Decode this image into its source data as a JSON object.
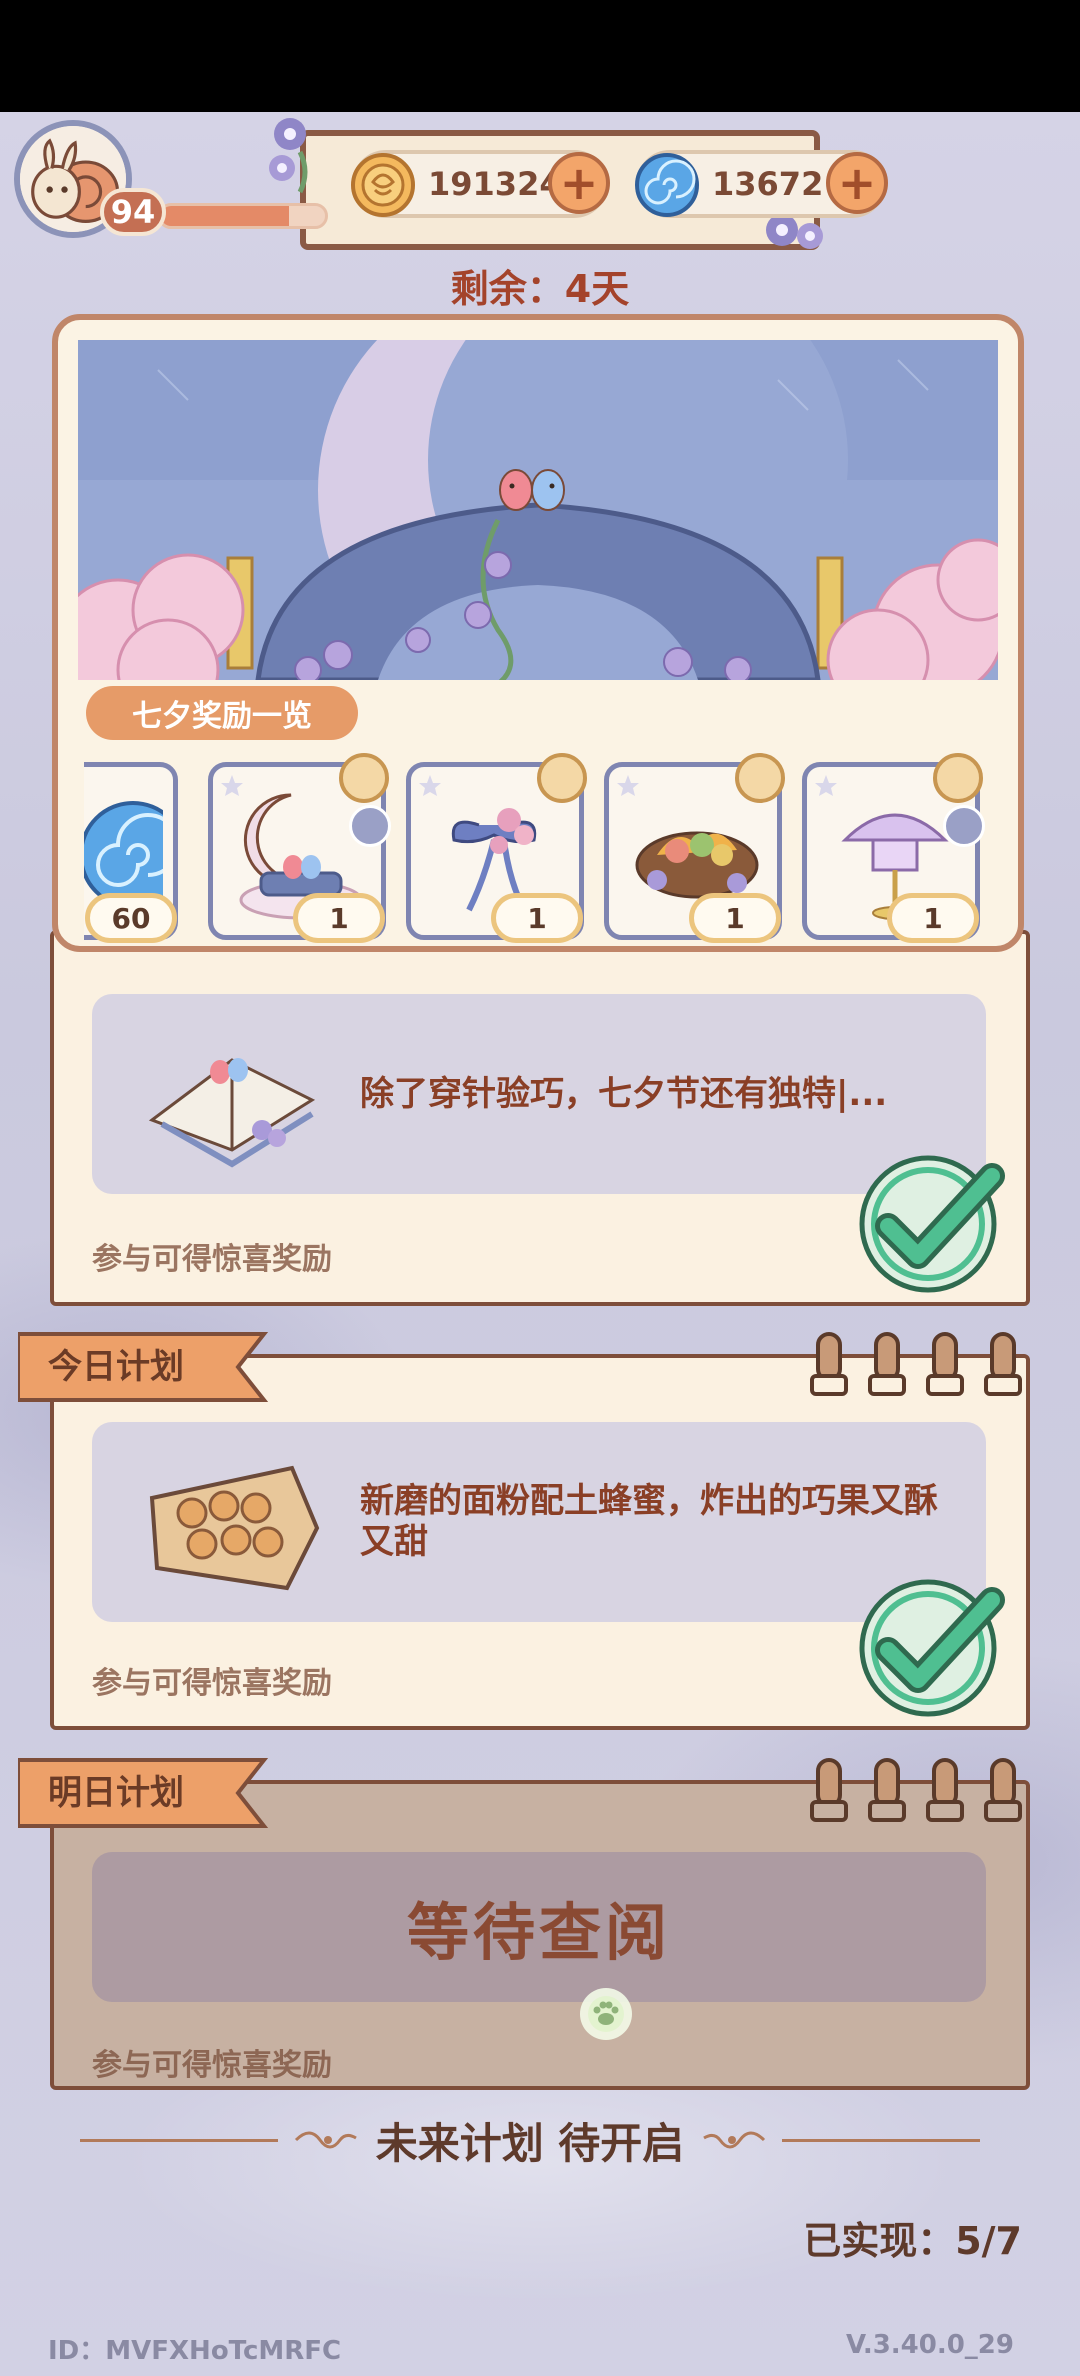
{
  "hud": {
    "level": "94",
    "exp_fraction": 0.78,
    "coins": "191324",
    "gems": "13672",
    "plus_symbol": "+"
  },
  "event": {
    "remaining": "剩余：4天",
    "reward_list_label": "七夕奖励一览",
    "rewards": [
      {
        "name": "blue-swirl-gem",
        "count": "60"
      },
      {
        "name": "moon-bird-bed",
        "count": "1"
      },
      {
        "name": "flower-ribbon",
        "count": "1"
      },
      {
        "name": "fruit-basket",
        "count": "1"
      },
      {
        "name": "lamp-umbrella",
        "count": "1"
      }
    ]
  },
  "plans": [
    {
      "label": "",
      "description": "除了穿针验巧，七夕节还有独特|...",
      "reward_text": "参与可得惊喜奖励",
      "completed": true
    },
    {
      "label": "今日计划",
      "description": "新磨的面粉配土蜂蜜，炸出的巧果又酥又甜",
      "reward_text": "参与可得惊喜奖励",
      "completed": true
    },
    {
      "label": "明日计划",
      "description": "等待查阅",
      "reward_text": "参与可得惊喜奖励",
      "completed": false
    }
  ],
  "future_text": "未来计划 待开启",
  "achieved": "已实现：5/7",
  "footer": {
    "id": "ID：MVFXHoTcMRFC",
    "version": "V.3.40.0_29"
  },
  "colors": {
    "accent_orange": "#e69b68",
    "check_green": "#4fbf91",
    "card_border": "#7e4e3a"
  }
}
